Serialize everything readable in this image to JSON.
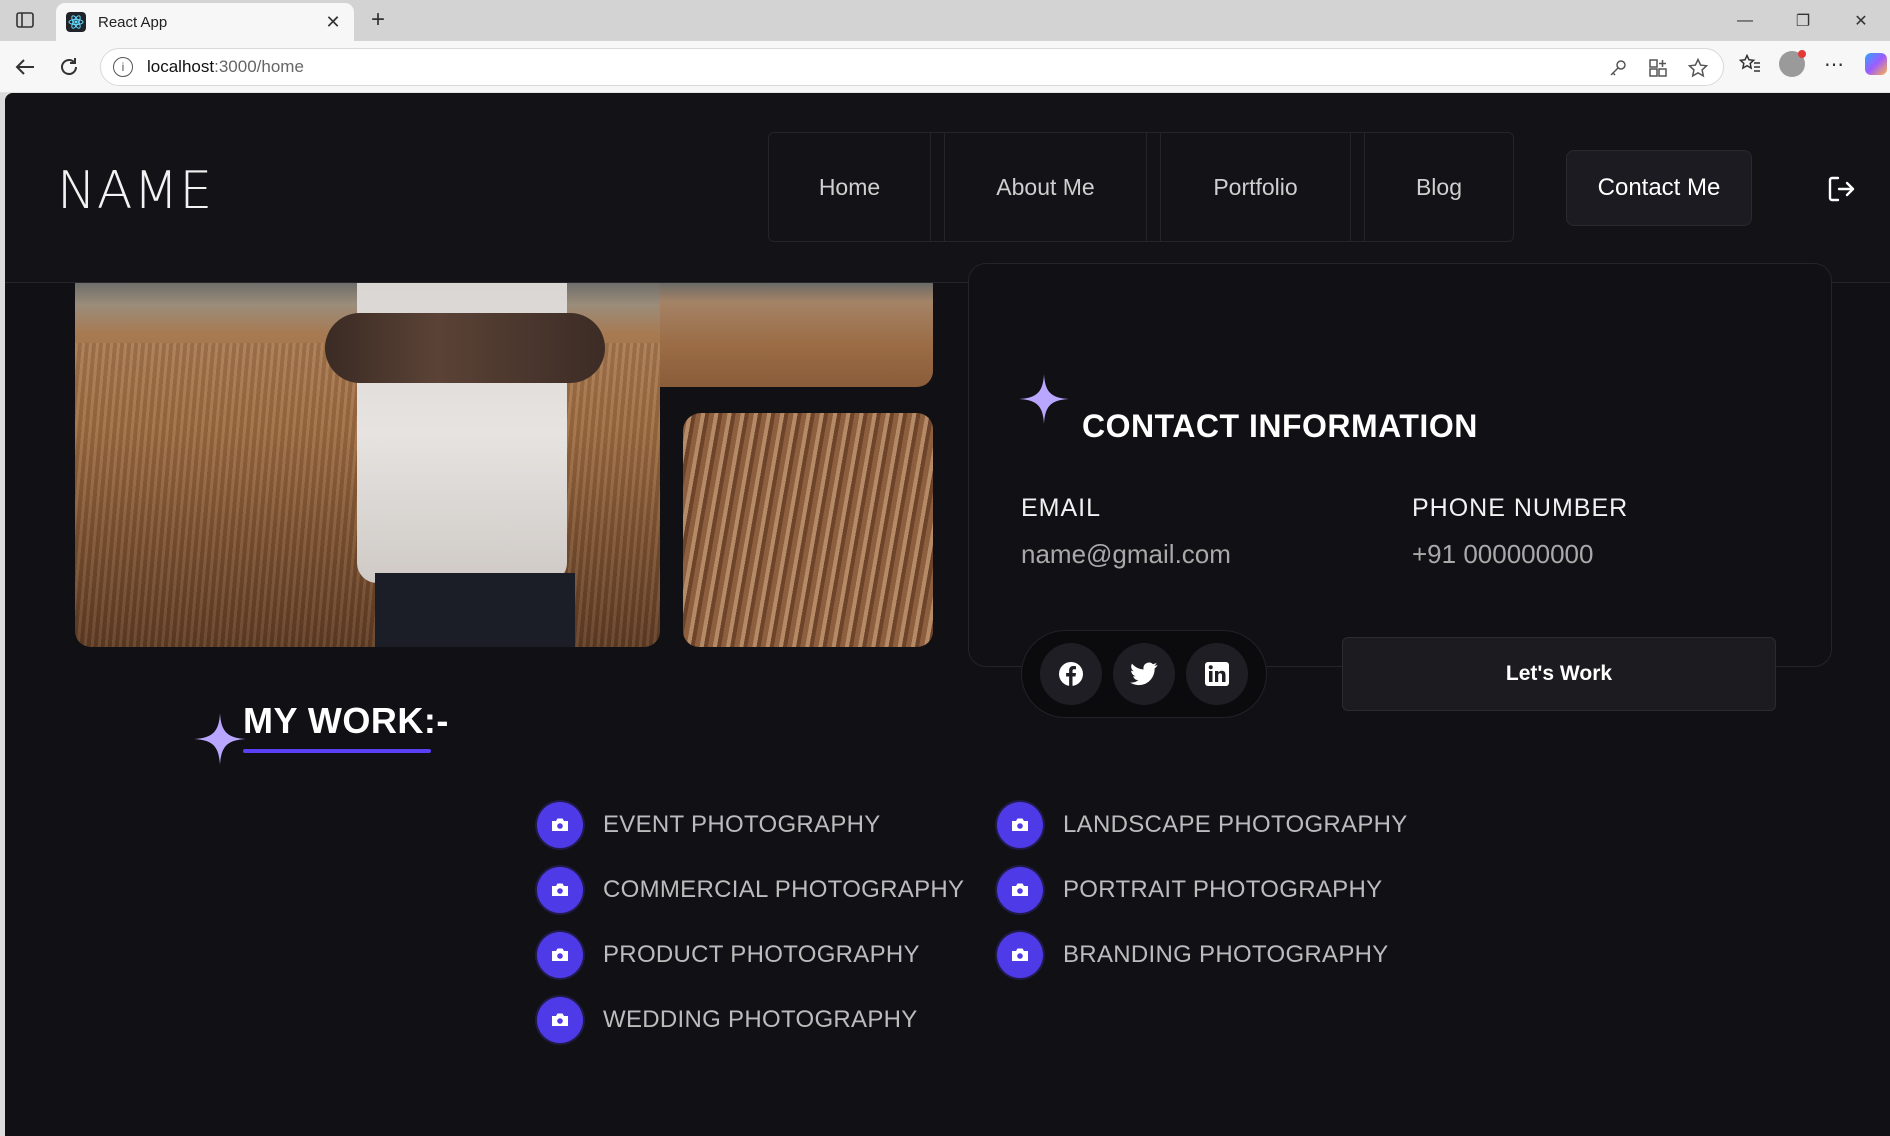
{
  "browser": {
    "tab_title": "React App",
    "url_host": "localhost",
    "url_path": ":3000/home"
  },
  "header": {
    "brand": "NAME",
    "nav": [
      "Home",
      "About Me",
      "Portfolio",
      "Blog"
    ],
    "contact_button": "Contact Me"
  },
  "contact": {
    "title": "CONTACT INFORMATION",
    "email_label": "EMAIL",
    "email_value": "name@gmail.com",
    "phone_label": "PHONE NUMBER",
    "phone_value": "+91 000000000",
    "cta": "Let's Work",
    "socials": [
      "facebook-icon",
      "twitter-icon",
      "linkedin-icon"
    ]
  },
  "work": {
    "title": "MY WORK:-",
    "col1": [
      "EVENT PHOTOGRAPHY",
      "COMMERCIAL PHOTOGRAPHY",
      "PRODUCT PHOTOGRAPHY",
      "WEDDING PHOTOGRAPHY"
    ],
    "col2": [
      "LANDSCAPE PHOTOGRAPHY",
      "PORTRAIT PHOTOGRAPHY",
      "BRANDING PHOTOGRAPHY"
    ]
  },
  "colors": {
    "accent": "#4f3ae8",
    "background": "#111014",
    "sparkle": "#b9a6ff"
  }
}
